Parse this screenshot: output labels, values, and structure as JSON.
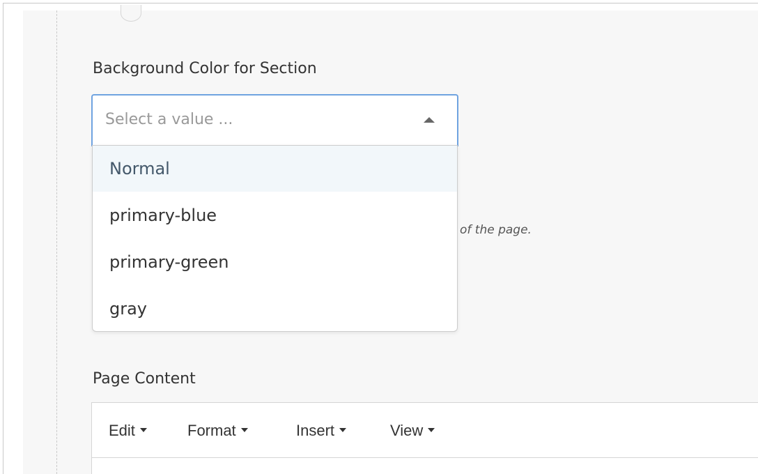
{
  "form": {
    "background_field": {
      "label": "Background Color for Section",
      "placeholder": "Select a value ...",
      "options": [
        {
          "label": "Normal",
          "highlighted": true
        },
        {
          "label": "primary-blue",
          "highlighted": false
        },
        {
          "label": "primary-green",
          "highlighted": false
        },
        {
          "label": "gray",
          "highlighted": false
        }
      ],
      "help_text_visible": "of the page."
    },
    "page_content_field": {
      "label": "Page Content",
      "menubar": [
        {
          "label": "Edit",
          "icon": "chevron-down-icon"
        },
        {
          "label": "Format",
          "icon": "chevron-down-icon"
        },
        {
          "label": "Insert",
          "icon": "chevron-down-icon"
        },
        {
          "label": "View",
          "icon": "chevron-down-icon"
        }
      ]
    }
  },
  "colors": {
    "focus_border": "#6fa3e0",
    "highlight_bg": "#f2f7fa",
    "panel_bg": "#f7f7f7"
  }
}
